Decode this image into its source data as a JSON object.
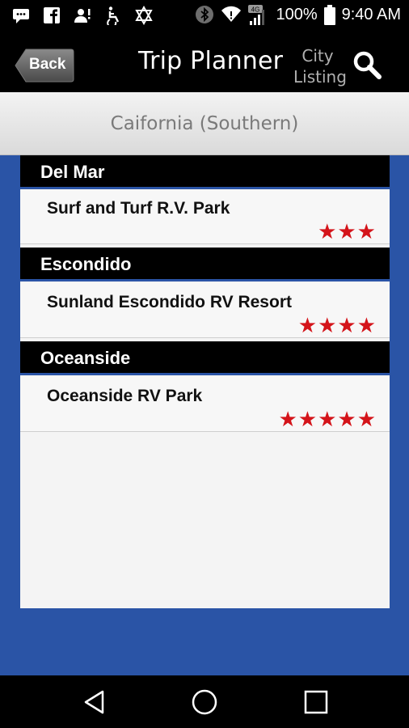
{
  "status_bar": {
    "battery_text": "100%",
    "time": "9:40 AM",
    "network_badge": "4G",
    "icons": [
      "message-icon",
      "facebook-icon",
      "person-alert-icon",
      "accessibility-icon",
      "star-of-david-icon",
      "bluetooth-icon",
      "wifi-icon",
      "signal-icon",
      "battery-icon"
    ]
  },
  "header": {
    "back_label": "Back",
    "title": "Trip Planner",
    "city_listing_line1": "City",
    "city_listing_line2": "Listing"
  },
  "region": {
    "label": "Caifornia (Southern)"
  },
  "listings": [
    {
      "city": "Del Mar",
      "park": "Surf and Turf R.V. Park",
      "rating": 3,
      "stars": "★★★"
    },
    {
      "city": "Escondido",
      "park": "Sunland Escondido RV Resort",
      "rating": 4,
      "stars": "★★★★"
    },
    {
      "city": "Oceanside",
      "park": "Oceanside RV Park",
      "rating": 5,
      "stars": "★★★★★"
    }
  ],
  "colors": {
    "accent_blue": "#2a54a6",
    "star_red": "#d4141a",
    "header_black": "#000000"
  }
}
